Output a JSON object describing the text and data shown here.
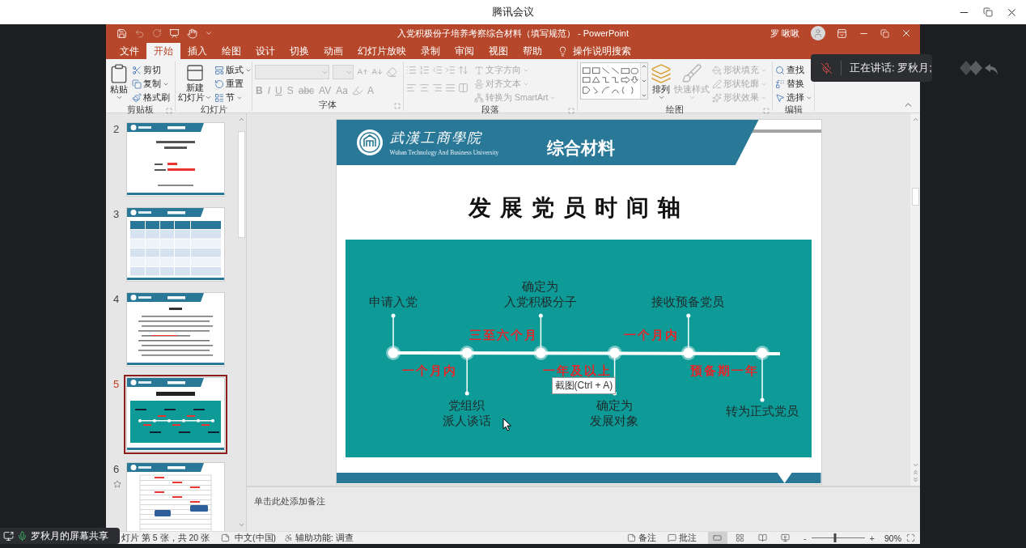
{
  "meeting": {
    "title": "腾讯会议"
  },
  "ppt": {
    "title": "入党积极份子培养考察综合材料（填写规范） - PowerPoint",
    "user": "罗 啾啾",
    "tabs": [
      {
        "label": "文件",
        "selected": false
      },
      {
        "label": "开始",
        "selected": true
      },
      {
        "label": "插入",
        "selected": false
      },
      {
        "label": "绘图",
        "selected": false
      },
      {
        "label": "设计",
        "selected": false
      },
      {
        "label": "切换",
        "selected": false
      },
      {
        "label": "动画",
        "selected": false
      },
      {
        "label": "幻灯片放映",
        "selected": false
      },
      {
        "label": "录制",
        "selected": false
      },
      {
        "label": "审阅",
        "selected": false
      },
      {
        "label": "视图",
        "selected": false
      },
      {
        "label": "帮助",
        "selected": false
      }
    ],
    "tell_me": "操作说明搜索",
    "ribbon": {
      "groups": [
        {
          "label": "剪贴板",
          "kind": "stack",
          "launcher": true,
          "items": [
            {
              "kind": "large",
              "lines": [
                "粘贴"
              ],
              "dropdown": true,
              "disabled": false
            },
            {
              "kind": "small",
              "lines": [
                "剪切"
              ],
              "dropdown": false,
              "disabled": false
            },
            {
              "kind": "small",
              "lines": [
                "复制"
              ],
              "dropdown": true,
              "disabled": false
            },
            {
              "kind": "small",
              "lines": [
                "格式刷"
              ],
              "dropdown": false,
              "disabled": false
            }
          ]
        },
        {
          "label": "幻灯片",
          "kind": "stack",
          "launcher": false,
          "items": [
            {
              "kind": "large",
              "lines": [
                "新建",
                "幻灯片"
              ],
              "dropdown": true,
              "disabled": false
            },
            {
              "kind": "small",
              "lines": [
                "版式"
              ],
              "dropdown": true,
              "disabled": false
            },
            {
              "kind": "small",
              "lines": [
                "重置"
              ],
              "dropdown": false,
              "disabled": false
            },
            {
              "kind": "small",
              "lines": [
                "节"
              ],
              "dropdown": true,
              "disabled": false
            }
          ]
        },
        {
          "label": "字体",
          "kind": "font",
          "launcher": true,
          "font_name_box": {
            "disabled": true
          },
          "font_size_box": {
            "disabled": true
          },
          "icon_buttons_disabled": true,
          "buttons": [
            {
              "label": "B",
              "disabled": true
            },
            {
              "label": "I",
              "disabled": true
            },
            {
              "label": "U",
              "disabled": true
            },
            {
              "label": "S",
              "disabled": true
            },
            {
              "label": "abc",
              "disabled": true
            },
            {
              "label": "AV",
              "disabled": true
            },
            {
              "label": "Aa",
              "disabled": true
            },
            {
              "label": "A",
              "disabled": true
            }
          ]
        },
        {
          "label": "段落",
          "kind": "paragraph",
          "launcher": true,
          "icon_buttons_disabled": true,
          "items": [
            {
              "kind": "small",
              "lines": [
                "文字方向"
              ],
              "dropdown": true,
              "disabled": true
            },
            {
              "kind": "small",
              "lines": [
                "对齐文本"
              ],
              "dropdown": true,
              "disabled": true
            },
            {
              "kind": "small",
              "lines": [
                "转换为 SmartArt"
              ],
              "dropdown": true,
              "disabled": true
            }
          ]
        },
        {
          "label": "绘图",
          "kind": "drawing",
          "launcher": true,
          "items": [
            {
              "kind": "large",
              "lines": [
                "排列"
              ],
              "dropdown": true,
              "disabled": false
            },
            {
              "kind": "large",
              "lines": [
                "快速样式"
              ],
              "dropdown": true,
              "disabled": true
            },
            {
              "kind": "small",
              "lines": [
                "形状填充"
              ],
              "dropdown": true,
              "disabled": true
            },
            {
              "kind": "small",
              "lines": [
                "形状轮廓"
              ],
              "dropdown": true,
              "disabled": true
            },
            {
              "kind": "small",
              "lines": [
                "形状效果"
              ],
              "dropdown": true,
              "disabled": true
            }
          ]
        },
        {
          "label": "编辑",
          "kind": "stack",
          "launcher": false,
          "items": [
            {
              "kind": "small",
              "lines": [
                "查找"
              ],
              "dropdown": false,
              "disabled": false
            },
            {
              "kind": "small",
              "lines": [
                "替换"
              ],
              "dropdown": false,
              "disabled": false
            },
            {
              "kind": "small",
              "lines": [
                "选择"
              ],
              "dropdown": true,
              "disabled": false
            }
          ]
        }
      ]
    },
    "thumbnails": [
      {
        "number": "2",
        "kind": "cover",
        "selected": false,
        "animated": false
      },
      {
        "number": "3",
        "kind": "table",
        "selected": false,
        "animated": false
      },
      {
        "number": "4",
        "kind": "text",
        "selected": false,
        "animated": false
      },
      {
        "number": "5",
        "kind": "timeline",
        "selected": true,
        "animated": false
      },
      {
        "number": "6",
        "kind": "form",
        "selected": false,
        "animated": true
      }
    ],
    "slide": {
      "school_name": "武漢工商學院",
      "school_name_en": "Wuhan Technology And Business University",
      "header_title": "综合材料",
      "title": "发展党员时间轴",
      "timeline": {
        "nodes": [
          {
            "lines": [
              "申请入党"
            ],
            "kind": "above"
          },
          {
            "lines": [
              "党组织",
              "派人谈话"
            ],
            "kind": "below"
          },
          {
            "lines": [
              "确定为",
              "入党积极分子"
            ],
            "kind": "above"
          },
          {
            "lines": [
              "确定为",
              "发展对象"
            ],
            "kind": "below"
          },
          {
            "lines": [
              "接收预备党员"
            ],
            "kind": "above"
          },
          {
            "lines": [
              "转为正式党员"
            ],
            "kind": "below"
          }
        ],
        "intervals": [
          {
            "text": "一个月内",
            "kind": "below"
          },
          {
            "text": "三至六个月",
            "kind": "above"
          },
          {
            "text": "一年及以上",
            "kind": "below"
          },
          {
            "text": "一个月内",
            "kind": "above"
          },
          {
            "text": "预备期一年",
            "kind": "below"
          }
        ]
      },
      "tooltip": "截图(Ctrl + A)"
    },
    "notes": {
      "prompt": "单击此处添加备注"
    },
    "status_bar": {
      "slide_info": "灯片 第 5 张，共 20 张",
      "language": "中文(中国)",
      "accessibility": "辅助功能: 调查",
      "notes_button": "备注",
      "comments_button": "批注",
      "views": [
        {
          "selected": true
        },
        {
          "selected": false
        },
        {
          "selected": false
        },
        {
          "selected": false
        }
      ],
      "zoom": {
        "minus": "-",
        "plus": "+",
        "level": 0.45,
        "reading": "90%"
      }
    }
  },
  "speaker_toast": {
    "text": "正在讲话: 罗秋月;"
  },
  "share_badge": {
    "text": "罗秋月的屏幕共享"
  }
}
